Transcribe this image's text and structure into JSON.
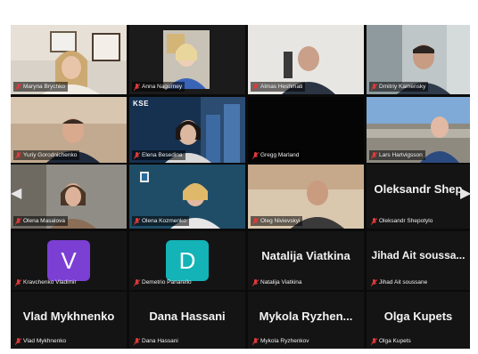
{
  "colors": {
    "active_speaker": "#3fbf4a",
    "muted_icon": "#e03a3a",
    "avatar_v": "#7b3fd4",
    "avatar_d": "#14b3b8"
  },
  "participants": [
    {
      "name": "Maryna Brychko",
      "type": "video"
    },
    {
      "name": "Anna Nagurney",
      "type": "video"
    },
    {
      "name": "Almas Heshmati",
      "type": "video",
      "active": true
    },
    {
      "name": "Dmitriy Kamensky",
      "type": "video"
    },
    {
      "name": "Yuriy Gorodnichenko",
      "type": "video"
    },
    {
      "name": "Elena Besedina",
      "type": "video",
      "background_logo": "KSE"
    },
    {
      "name": "Gregg Marland",
      "type": "video-off"
    },
    {
      "name": "Lars Hartvigsson",
      "type": "video"
    },
    {
      "name": "Olena Masalova",
      "type": "video"
    },
    {
      "name": "Olena Kozmenko",
      "type": "video"
    },
    {
      "name": "Oleg Nivievskyi",
      "type": "video"
    },
    {
      "name": "Oleksandr Shepotylo",
      "type": "name",
      "display": "Oleksandr Shep"
    },
    {
      "name": "Kravchenko Vladimir",
      "type": "avatar",
      "initial": "V"
    },
    {
      "name": "Demetrio Panarello",
      "type": "avatar",
      "initial": "D"
    },
    {
      "name": "Natalija Viatkina",
      "type": "name",
      "display": "Natalija Viatkina"
    },
    {
      "name": "Jihad Ait soussane",
      "type": "name",
      "display": "Jihad Ait soussa..."
    },
    {
      "name": "Vlad Mykhnenko",
      "type": "name",
      "display": "Vlad Mykhnenko"
    },
    {
      "name": "Dana Hassani",
      "type": "name",
      "display": "Dana Hassani"
    },
    {
      "name": "Mykola Ryzhenkov",
      "type": "name",
      "display": "Mykola Ryzhen..."
    },
    {
      "name": "Olga Kupets",
      "type": "name",
      "display": "Olga Kupets"
    }
  ],
  "icons": {
    "muted": "mic-muted-icon",
    "nav_prev": "chevron-left-icon",
    "nav_next": "chevron-right-icon"
  }
}
